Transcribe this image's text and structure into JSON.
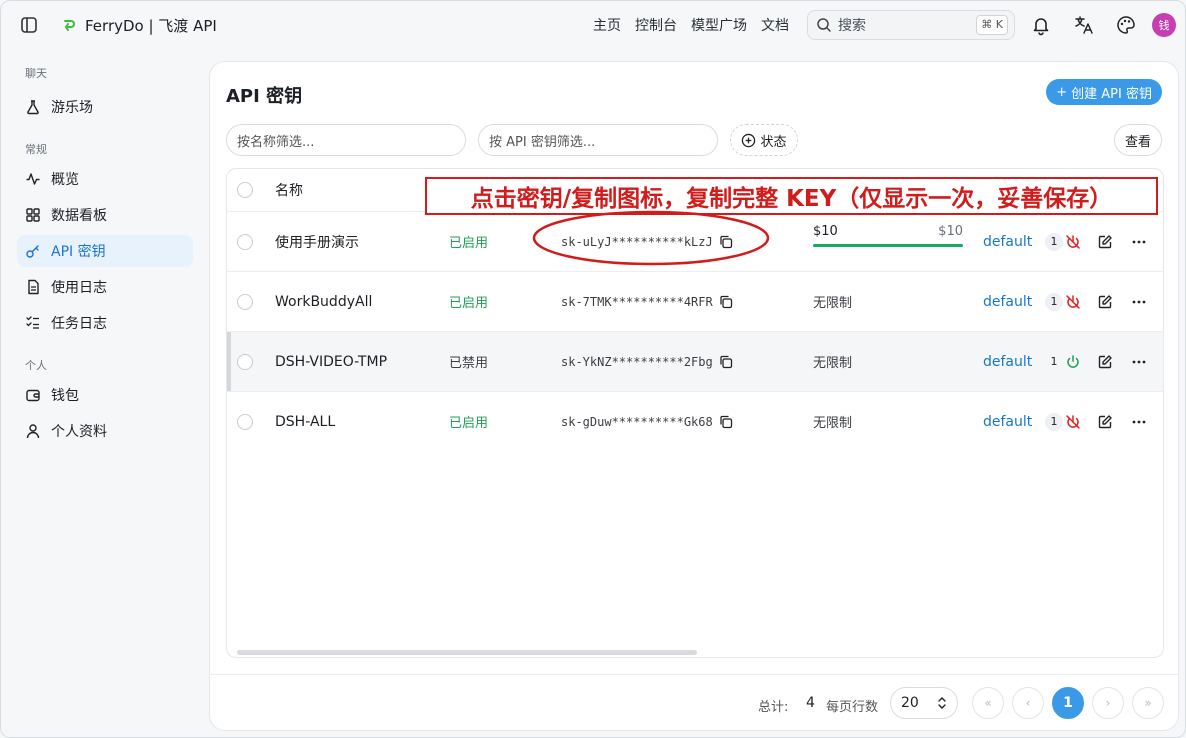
{
  "header": {
    "brand": "FerryDo | 飞渡 API",
    "nav": [
      "主页",
      "控制台",
      "模型广场",
      "文档"
    ],
    "search_placeholder": "搜索",
    "search_shortcut": "⌘ K",
    "avatar_text": "钱"
  },
  "sidebar": {
    "groups": [
      {
        "label": "聊天",
        "items": [
          {
            "label": "游乐场",
            "icon": "flask-icon"
          }
        ]
      },
      {
        "label": "常规",
        "items": [
          {
            "label": "概览",
            "icon": "pulse-icon"
          },
          {
            "label": "数据看板",
            "icon": "grid-icon"
          },
          {
            "label": "API 密钥",
            "icon": "key-icon",
            "active": true
          },
          {
            "label": "使用日志",
            "icon": "document-icon"
          },
          {
            "label": "任务日志",
            "icon": "task-list-icon"
          }
        ]
      },
      {
        "label": "个人",
        "items": [
          {
            "label": "钱包",
            "icon": "wallet-icon"
          },
          {
            "label": "个人资料",
            "icon": "user-icon"
          }
        ]
      }
    ]
  },
  "main": {
    "title": "API 密钥",
    "create_label": "创建 API 密钥",
    "filter_name_placeholder": "按名称筛选...",
    "filter_key_placeholder": "按 API 密钥筛选...",
    "status_label": "状态",
    "query_label": "查看",
    "table": {
      "header_name": "名称",
      "rows": [
        {
          "name": "使用手册演示",
          "status": "已启用",
          "key": "sk-uLyJ**********kLzJ",
          "quota_remaining": "$10",
          "quota_total": "$10",
          "quota_fraction": 1.0,
          "group": "default",
          "count": "1",
          "enabled": true
        },
        {
          "name": "WorkBuddyAll",
          "status": "已启用",
          "key": "sk-7TMK**********4RFR",
          "quota": "无限制",
          "group": "default",
          "count": "1",
          "enabled": true
        },
        {
          "name": "DSH-VIDEO-TMP",
          "status": "已禁用",
          "key": "sk-YkNZ**********2Fbg",
          "quota": "无限制",
          "group": "default",
          "count": "1",
          "enabled": false
        },
        {
          "name": "DSH-ALL",
          "status": "已启用",
          "key": "sk-gDuw**********Gk68",
          "quota": "无限制",
          "group": "default",
          "count": "1",
          "enabled": true
        }
      ]
    },
    "pagination": {
      "total_label": "总计:",
      "total_value": "4",
      "per_page_label": "每页行数",
      "per_page_value": "20",
      "current_page": "1",
      "first": "«",
      "prev": "‹",
      "next": "›",
      "last": "»"
    }
  },
  "annotation": {
    "callout_text": "点击密钥/复制图标，复制完整 KEY（仅显示一次，妥善保存）",
    "color": "#d21b1b"
  },
  "colors": {
    "accent": "#3b9ae8",
    "enabled": "#1e9e53",
    "link": "#1677c7",
    "danger": "#e02020"
  }
}
